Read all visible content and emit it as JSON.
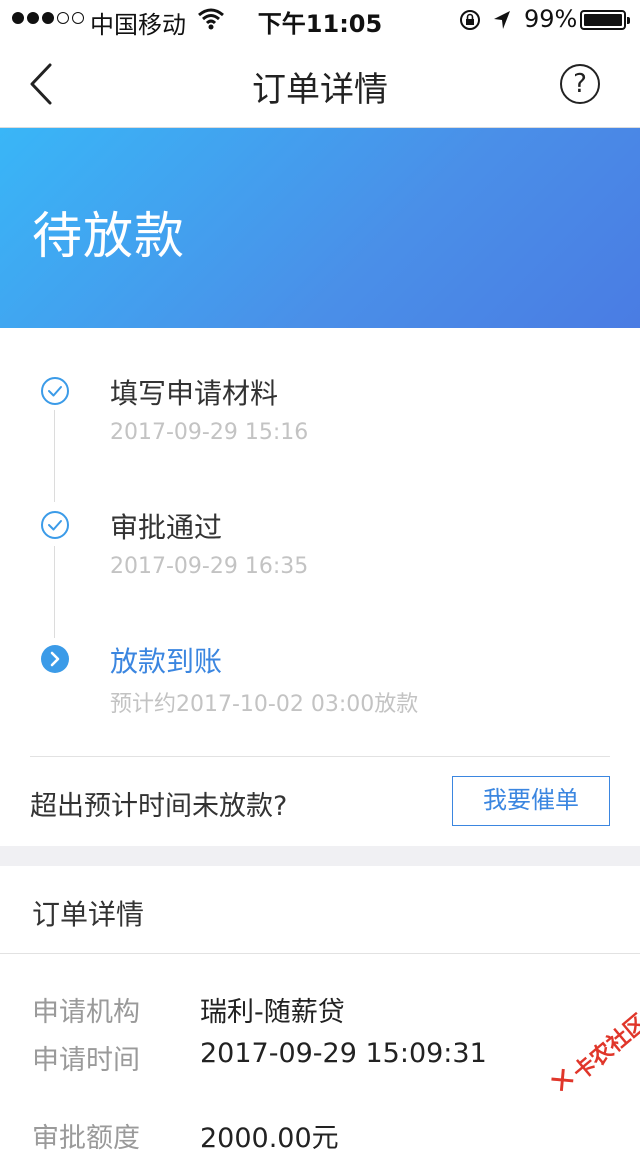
{
  "status_bar": {
    "carrier": "中国移动",
    "time": "下午11:05",
    "battery": "99%"
  },
  "nav": {
    "title": "订单详情",
    "help_symbol": "?"
  },
  "banner": {
    "status": "待放款"
  },
  "timeline": {
    "steps": [
      {
        "title": "填写申请材料",
        "time": "2017-09-29 15:16"
      },
      {
        "title": "审批通过",
        "time": "2017-09-29 16:35"
      },
      {
        "title": "放款到账",
        "time": "预计约2017-10-02 03:00放款"
      }
    ],
    "overdue_question": "超出预计时间未放款?",
    "urge_button": "我要催单"
  },
  "details": {
    "title": "订单详情",
    "rows": [
      {
        "label": "申请机构",
        "value": "瑞利-随薪贷"
      },
      {
        "label": "申请时间",
        "value": "2017-09-29 15:09:31"
      },
      {
        "label": "审批额度",
        "value": "2000.00元"
      }
    ]
  },
  "watermark": {
    "text": "卡农社区"
  },
  "colors": {
    "accent": "#3b86e0",
    "banner_start": "#39b6f7",
    "banner_end": "#4a7ce3"
  }
}
